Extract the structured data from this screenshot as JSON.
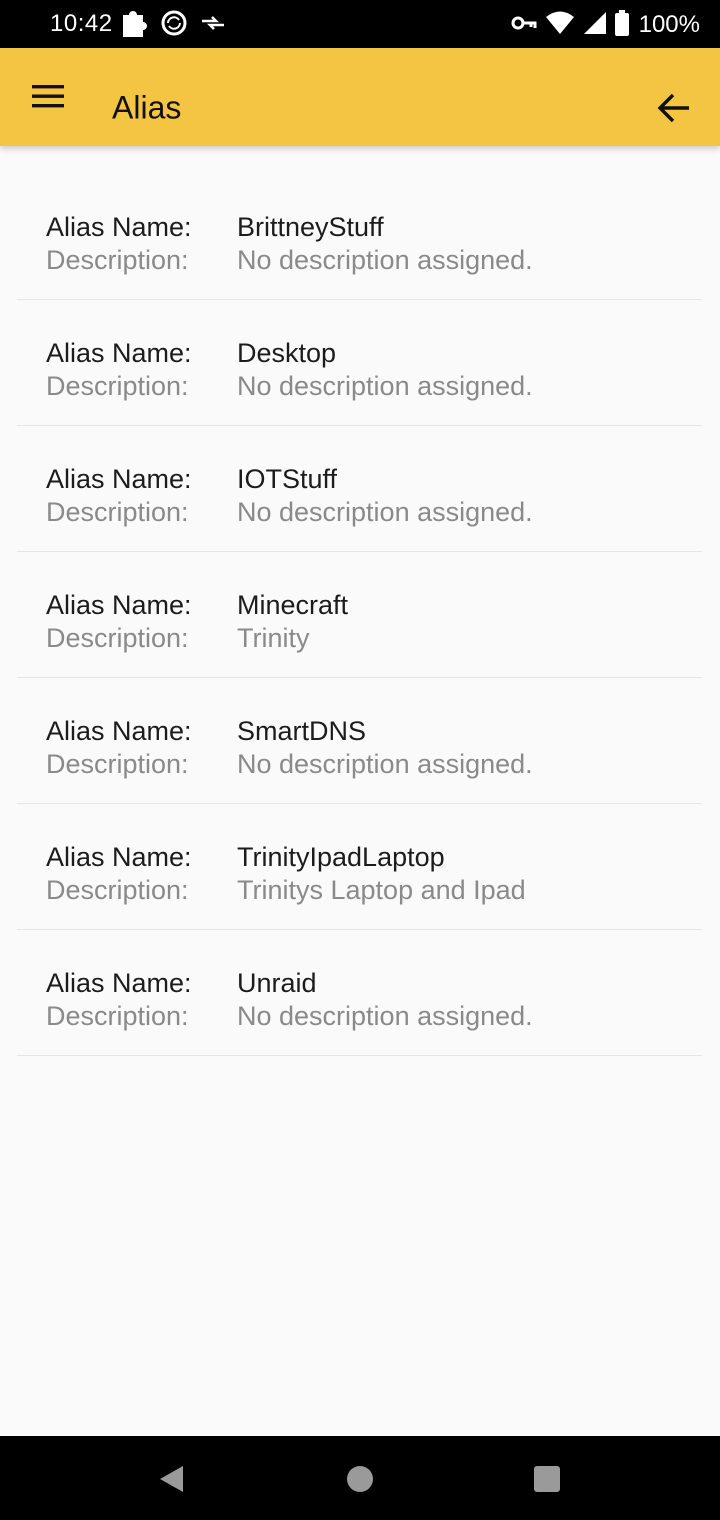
{
  "status_bar": {
    "time": "10:42",
    "battery": "100%",
    "icons_left": [
      "puzzle-icon",
      "sync-cloud-icon",
      "data-transfer-icon"
    ],
    "icons_right": [
      "vpn-key-icon",
      "wifi-icon",
      "cell-signal-icon",
      "battery-icon"
    ]
  },
  "toolbar": {
    "title": "Alias",
    "menu_icon": "hamburger-menu-icon",
    "back_icon": "arrow-back-icon",
    "background": "#f4c443"
  },
  "aliases": [
    {
      "name_label": "Alias Name:",
      "name": "BrittneyStuff",
      "desc_label": "Description:",
      "description": "No description assigned."
    },
    {
      "name_label": "Alias Name:",
      "name": "Desktop",
      "desc_label": "Description:",
      "description": "No description assigned."
    },
    {
      "name_label": "Alias Name:",
      "name": "IOTStuff",
      "desc_label": "Description:",
      "description": "No description assigned."
    },
    {
      "name_label": "Alias Name:",
      "name": "Minecraft",
      "desc_label": "Description:",
      "description": "Trinity"
    },
    {
      "name_label": "Alias Name:",
      "name": "SmartDNS",
      "desc_label": "Description:",
      "description": "No description assigned."
    },
    {
      "name_label": "Alias Name:",
      "name": "TrinityIpadLaptop",
      "desc_label": "Description:",
      "description": "Trinitys Laptop and Ipad"
    },
    {
      "name_label": "Alias Name:",
      "name": "Unraid",
      "desc_label": "Description:",
      "description": "No description assigned."
    }
  ],
  "nav_bar": {
    "buttons": [
      "nav-back-icon",
      "nav-home-icon",
      "nav-recents-icon"
    ]
  }
}
